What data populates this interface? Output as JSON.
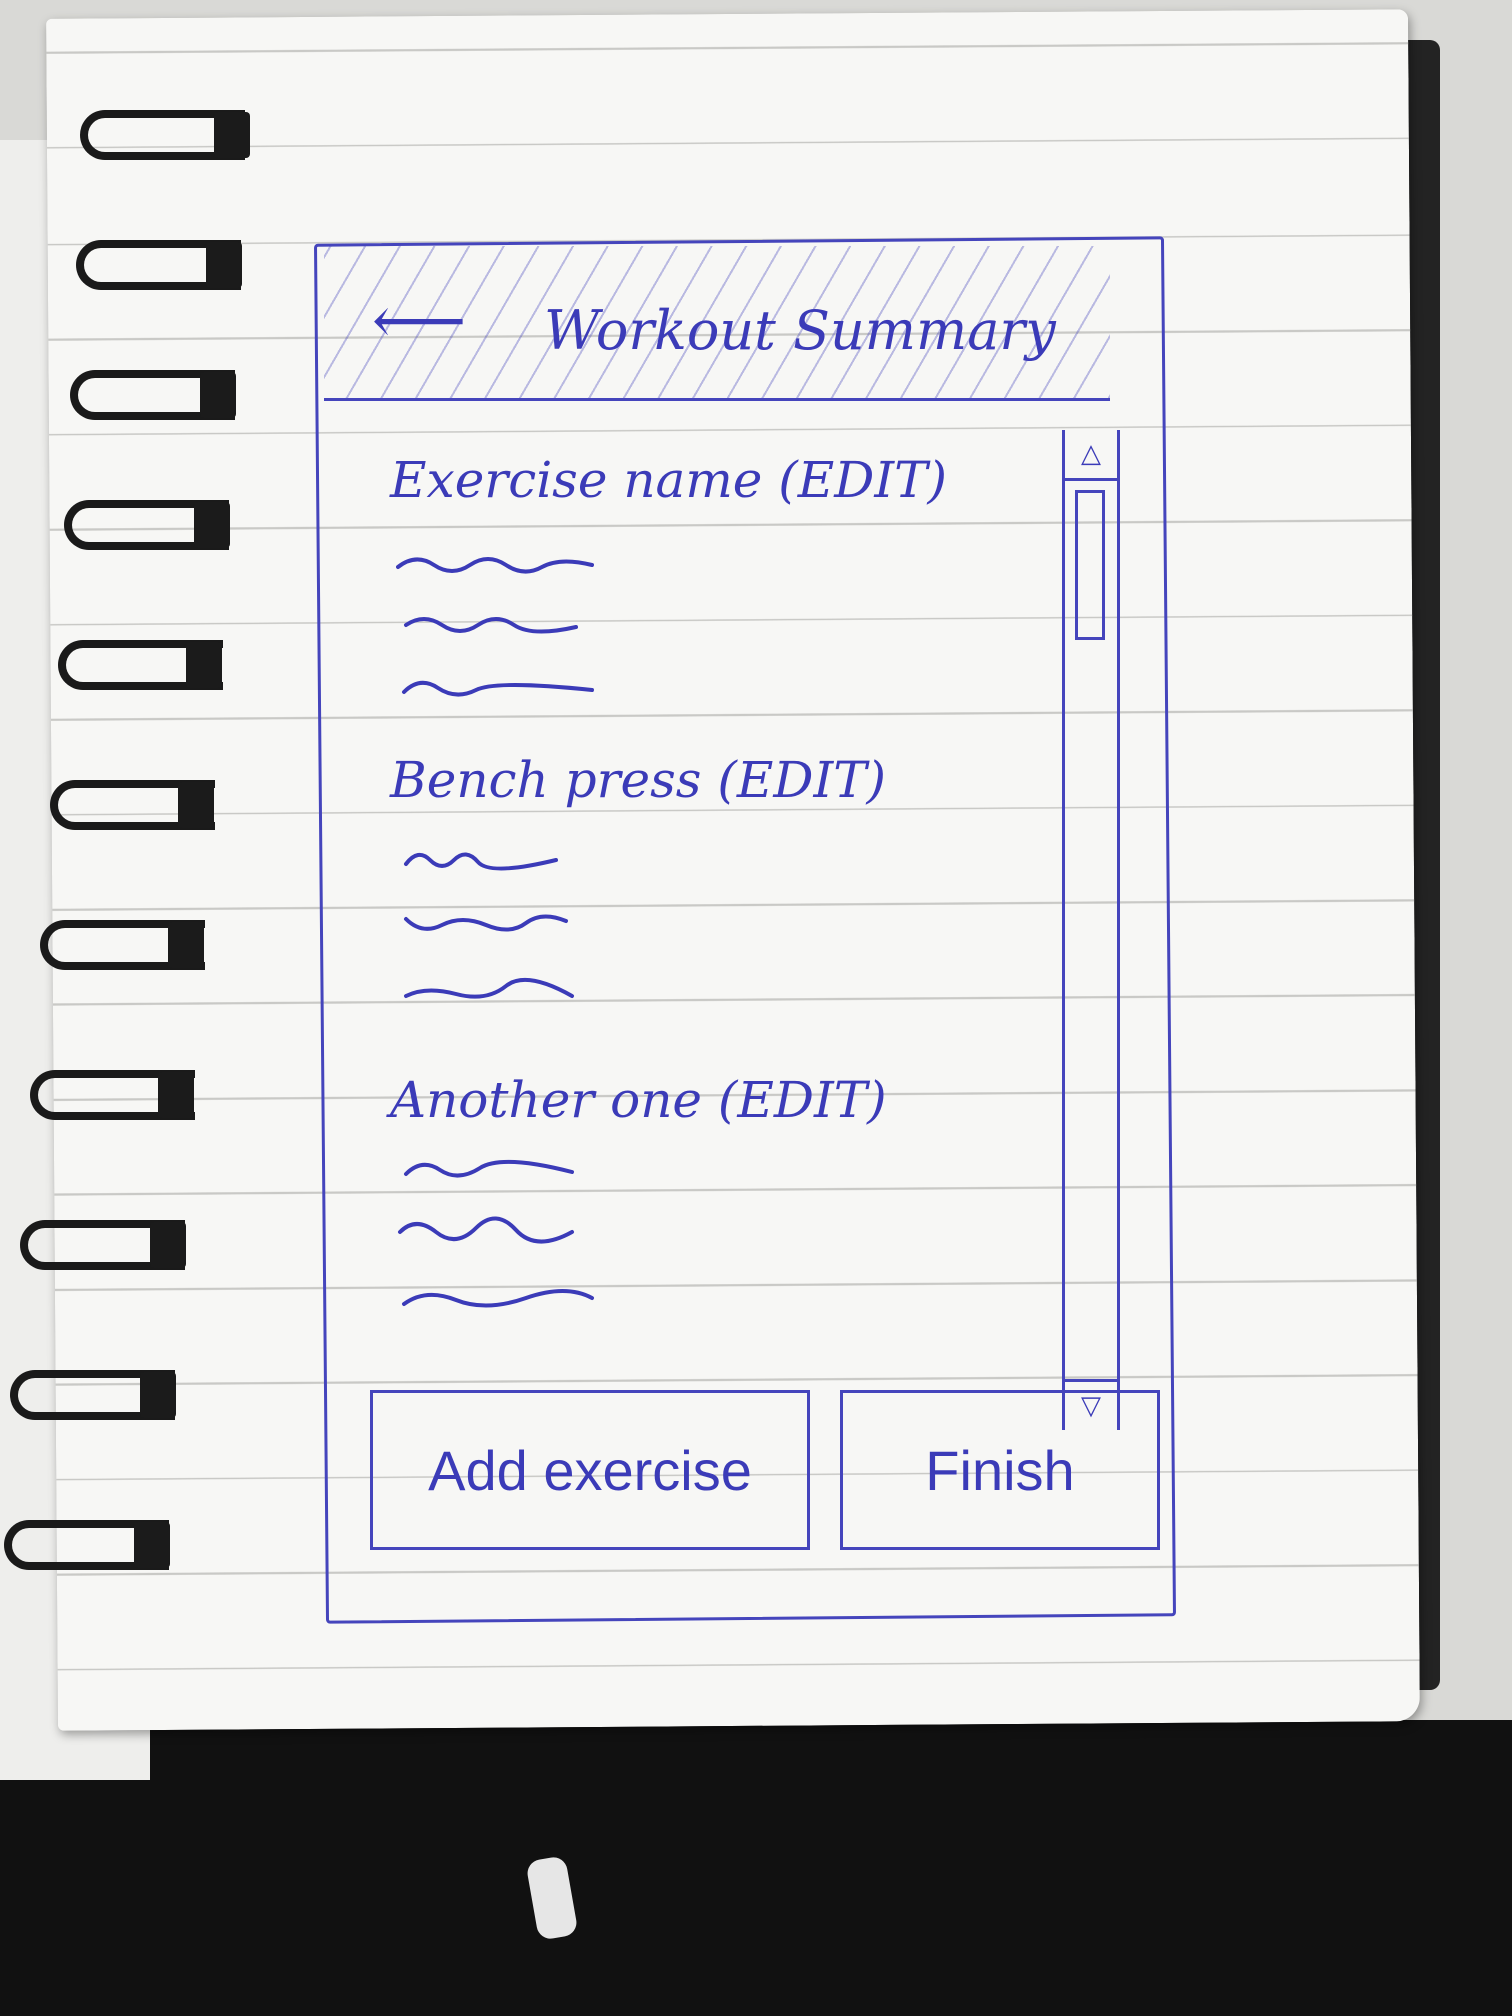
{
  "app": {
    "header": {
      "back_icon": "arrow-left-icon",
      "back_glyph": "⟵",
      "title": "Workout Summary"
    },
    "exercises": [
      {
        "name": "Exercise name",
        "edit_label": "(EDIT)"
      },
      {
        "name": "Bench press",
        "edit_label": "(EDIT)"
      },
      {
        "name": "Another one",
        "edit_label": "(EDIT)"
      }
    ],
    "scrollbar": {
      "up_icon": "triangle-up-icon",
      "up_glyph": "△",
      "down_icon": "triangle-down-icon",
      "down_glyph": "▽"
    },
    "actions": {
      "add_label": "Add exercise",
      "finish_label": "Finish"
    }
  },
  "colors": {
    "ink": "#3b3bb8",
    "paper": "#f7f7f5",
    "rule_line": "#c9c9c6"
  }
}
